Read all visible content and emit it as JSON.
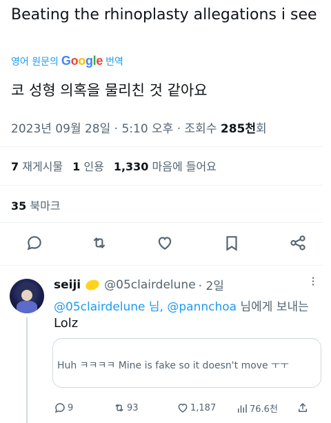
{
  "tweet": {
    "text": "Beating the rhinoplasty allegations i see",
    "translate_prefix": "영어 원문의",
    "translate_brand": [
      "G",
      "o",
      "o",
      "g",
      "l",
      "e"
    ],
    "translate_suffix": "번역",
    "translated_text": "코 성형 의혹을 물리친 것 같아요",
    "date": "2023년 09월 28일 · 5:10 오후 · 조회수 ",
    "views": "285천",
    "views_suffix": "회"
  },
  "stats": {
    "reposts": "7",
    "reposts_label": "재게시물",
    "quotes": "1",
    "quotes_label": "인용",
    "likes": "1,330",
    "likes_label": "마음에 들어요",
    "bookmarks": "35",
    "bookmarks_label": "북마크"
  },
  "actions": {
    "reply_icon": "reply-icon",
    "repost_icon": "repost-icon",
    "like_icon": "heart-icon",
    "bookmark_icon": "bookmark-icon",
    "share_icon": "share-icon"
  },
  "reply": {
    "name": "seiji",
    "emoji": "lemon",
    "handle": "@05clairdelune",
    "age": "· 2일",
    "replying_mention_1": "@05clairdelune 님,",
    "replying_mention_2": "@pannchoa",
    "replying_suffix": "님에게 보내는",
    "text": "Lolz",
    "quote_text": "Huh ㅋㅋㅋㅋ Mine is fake so it doesn't move ㅜㅜ",
    "replies": "9",
    "reposts": "93",
    "likes": "1,187",
    "views": "76.6천"
  },
  "colors": {
    "accent": "#1d9bf0",
    "text": "#0f1419",
    "muted": "#536471",
    "divider": "#eff3f4"
  }
}
